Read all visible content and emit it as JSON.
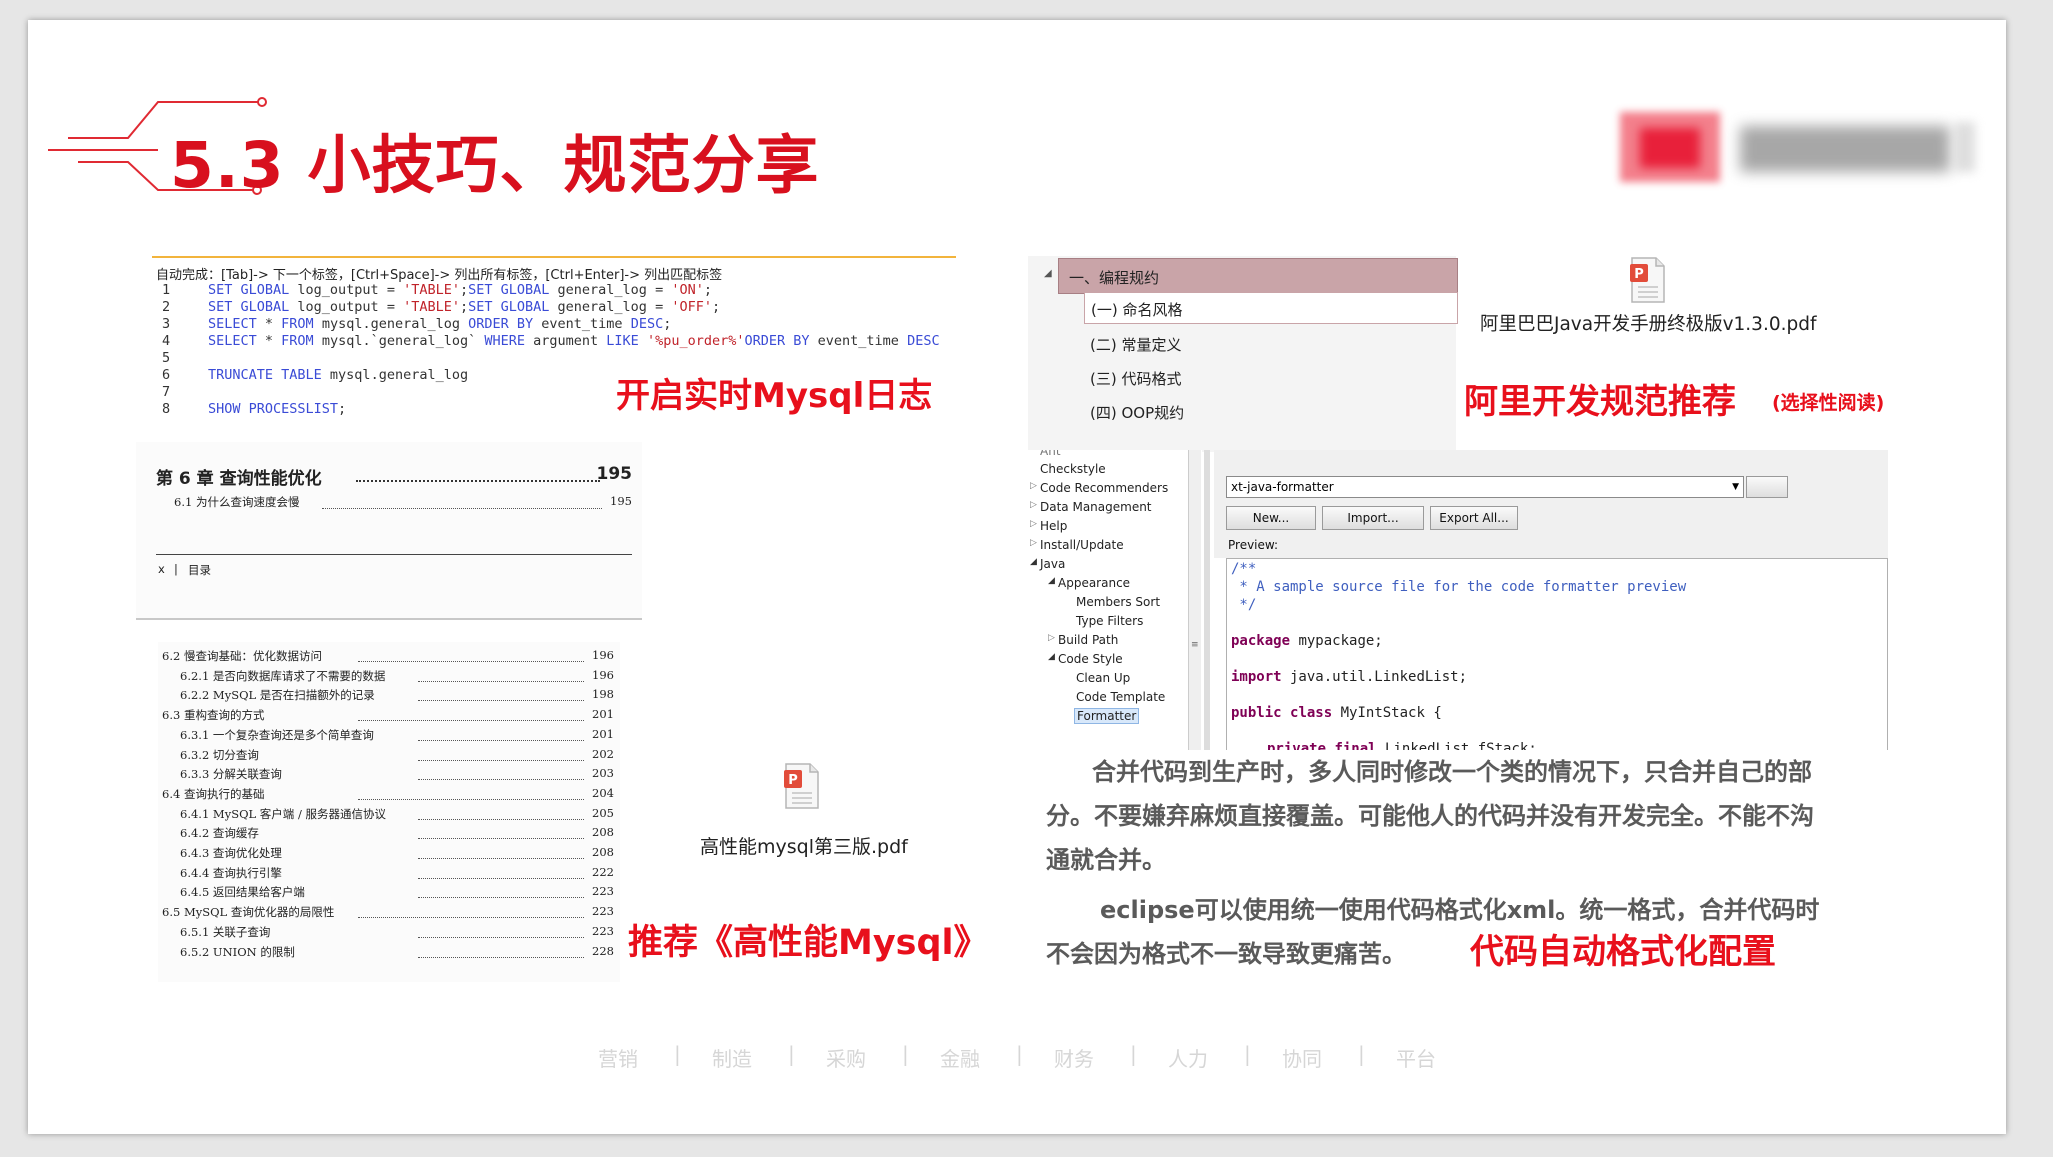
{
  "slide": {
    "title": "5.3 小技巧、规范分享"
  },
  "colors": {
    "accent": "#e8101c",
    "title": "#d8101e",
    "body_text": "#5a5a5a"
  },
  "mysql_log": {
    "hint": "自动完成：[Tab]-> 下一个标签，[Ctrl+Space]-> 列出所有标签，[Ctrl+Enter]-> 列出匹配标签",
    "line_numbers": [
      "1",
      "2",
      "3",
      "4",
      "5",
      "6",
      "7",
      "8"
    ],
    "callout": "开启实时Mysql日志"
  },
  "toc": {
    "chapter": "第 6 章  查询性能优化",
    "chapter_page": "195",
    "sub": "6.1  为什么查询速度会慢",
    "sub_page": "195",
    "footer_left": "x",
    "footer_sep": "|",
    "footer_label": "目录",
    "entries": [
      {
        "label": "6.2  慢查询基础：优化数据访问",
        "page": "196"
      },
      {
        "label": "6.2.1  是否向数据库请求了不需要的数据",
        "page": "196"
      },
      {
        "label": "6.2.2  MySQL 是否在扫描额外的记录",
        "page": "198"
      },
      {
        "label": "6.3  重构查询的方式",
        "page": "201"
      },
      {
        "label": "6.3.1  一个复杂查询还是多个简单查询",
        "page": "201"
      },
      {
        "label": "6.3.2  切分查询",
        "page": "202"
      },
      {
        "label": "6.3.3  分解关联查询",
        "page": "203"
      },
      {
        "label": "6.4  查询执行的基础",
        "page": "204"
      },
      {
        "label": "6.4.1  MySQL 客户端 / 服务器通信协议",
        "page": "205"
      },
      {
        "label": "6.4.2  查询缓存",
        "page": "208"
      },
      {
        "label": "6.4.3  查询优化处理",
        "page": "208"
      },
      {
        "label": "6.4.4  查询执行引擎",
        "page": "222"
      },
      {
        "label": "6.4.5  返回结果给客户端",
        "page": "223"
      },
      {
        "label": "6.5  MySQL 查询优化器的局限性",
        "page": "223"
      },
      {
        "label": "6.5.1  关联子查询",
        "page": "223"
      },
      {
        "label": "6.5.2  UNION 的限制",
        "page": "228"
      }
    ]
  },
  "book_pdf": {
    "filename": "高性能mysql第三版.pdf",
    "callout": "推荐《高性能Mysql》"
  },
  "spec": {
    "root": "一、编程规约",
    "items": [
      "(一) 命名风格",
      "(二) 常量定义",
      "(三) 代码格式",
      "(四) OOP规约"
    ],
    "pdf_name": "阿里巴巴Java开发手册终极版v1.3.0.pdf",
    "callout": "阿里开发规范推荐",
    "callout_note": "(选择性阅读)"
  },
  "eclipse": {
    "tree": {
      "ant": "Ant",
      "checkstyle": "Checkstyle",
      "code_recommenders": "Code Recommenders",
      "data_management": "Data Management",
      "help": "Help",
      "install_update": "Install/Update",
      "java": "Java",
      "appearance": "Appearance",
      "members_sort": "Members Sort",
      "type_filters": "Type Filters",
      "build_path": "Build Path",
      "code_style": "Code Style",
      "clean_up": "Clean Up",
      "code_templates": "Code Template",
      "formatter": "Formatter"
    },
    "profile": "xt-java-formatter",
    "buttons": {
      "new": "New...",
      "import": "Import...",
      "export": "Export All..."
    },
    "preview_label": "Preview:",
    "preview_code": {
      "c1": "/**",
      "c2": " * A sample source file for the code formatter preview",
      "c3": " */",
      "kw_package": "package",
      "pkg": " mypackage;",
      "kw_import": "import",
      "imp": " java.util.LinkedList;",
      "kw_public": "public",
      "kw_class": "class",
      "cls": " MyIntStack {",
      "kw_private": "private",
      "kw_final": "final",
      "field": " LinkedList fStack;"
    }
  },
  "merge_text": {
    "p1_l1": "合并代码到生产时，多人同时修改一个类的情况下，只合并自己的部",
    "p1_l2": "分。不要嫌弃麻烦直接覆盖。可能他人的代码并没有开发完全。不能不沟",
    "p1_l3": "通就合并。",
    "p2_l1": "eclipse可以使用统一使用代码格式化xml。统一格式，合并代码时",
    "p2_l2": "不会因为格式不一致导致更痛苦。",
    "callout": "代码自动格式化配置"
  },
  "footer": {
    "items": [
      "营销",
      "制造",
      "采购",
      "金融",
      "财务",
      "人力",
      "协同",
      "平台"
    ],
    "separator": "|"
  }
}
